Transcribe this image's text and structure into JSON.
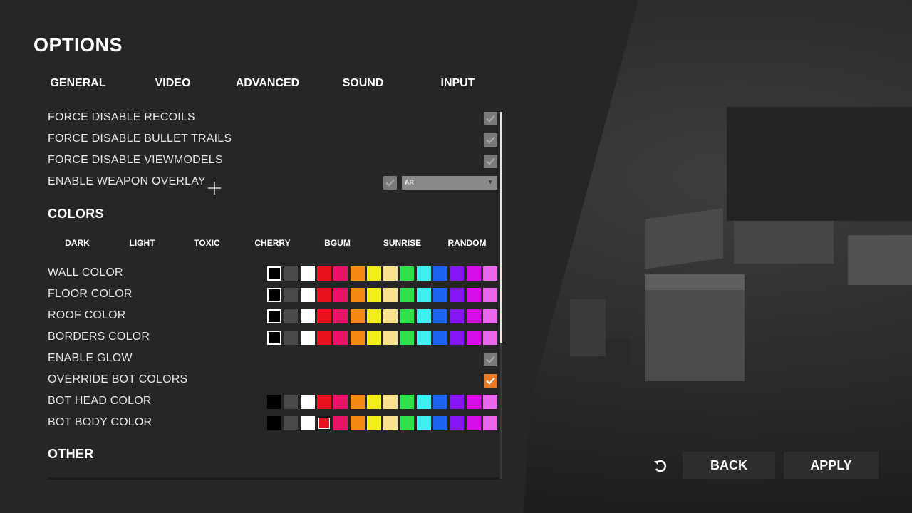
{
  "header": {
    "title": "OPTIONS"
  },
  "tabs": [
    {
      "label": "GENERAL"
    },
    {
      "label": "VIDEO"
    },
    {
      "label": "ADVANCED"
    },
    {
      "label": "SOUND"
    },
    {
      "label": "INPUT"
    }
  ],
  "settings": {
    "recoils": {
      "label": "FORCE DISABLE RECOILS",
      "checked": true
    },
    "bullet_trails": {
      "label": "FORCE DISABLE BULLET TRAILS",
      "checked": true
    },
    "viewmodels": {
      "label": "FORCE DISABLE VIEWMODELS",
      "checked": true
    },
    "weapon_overlay": {
      "label": "ENABLE WEAPON OVERLAY",
      "checked": true,
      "selected": "AR"
    }
  },
  "colors_section": {
    "heading": "COLORS",
    "presets": [
      "DARK",
      "LIGHT",
      "TOXIC",
      "CHERRY",
      "BGUM",
      "SUNRISE",
      "RANDOM"
    ],
    "palette": [
      "#000000",
      "#4a4a4a",
      "#ffffff",
      "#e8121e",
      "#ea1269",
      "#f48a0f",
      "#f2ee1a",
      "#f8e28c",
      "#2ee04a",
      "#3ff0f2",
      "#1b64f2",
      "#8518f2",
      "#d80ce8",
      "#ea66ea"
    ],
    "rows": {
      "wall": {
        "label": "WALL COLOR",
        "selected": "#000000"
      },
      "floor": {
        "label": "FLOOR COLOR",
        "selected": "#000000"
      },
      "roof": {
        "label": "ROOF COLOR",
        "selected": "#000000"
      },
      "borders": {
        "label": "BORDERS COLOR",
        "selected": "#000000"
      }
    },
    "enable_glow": {
      "label": "ENABLE GLOW",
      "checked": true
    },
    "override_bot": {
      "label": "OVERRIDE BOT COLORS",
      "checked": true
    },
    "bot_head": {
      "label": "BOT HEAD COLOR"
    },
    "bot_body": {
      "label": "BOT BODY COLOR",
      "selected": "#e8121e"
    }
  },
  "other_section": {
    "heading": "OTHER"
  },
  "footer": {
    "back_label": "BACK",
    "apply_label": "APPLY",
    "reset_icon": "undo-icon"
  },
  "theme": {
    "accent": "#e87a2a",
    "checkbox_gray": "#7a7a7a"
  }
}
